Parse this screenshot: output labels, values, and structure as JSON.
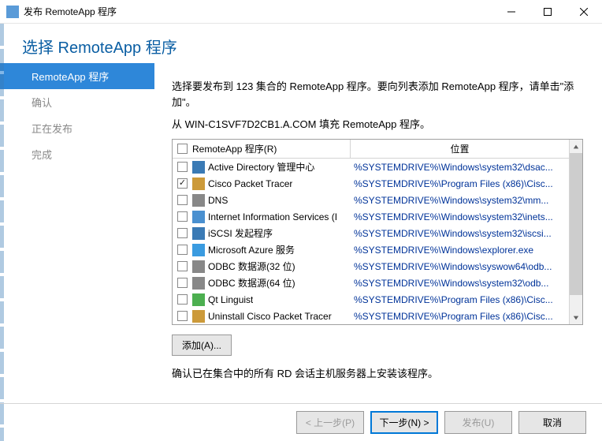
{
  "window": {
    "title": "发布 RemoteApp 程序",
    "min": "—",
    "max": "☐",
    "close": "✕"
  },
  "heading": "选择 RemoteApp 程序",
  "steps": [
    {
      "label": "RemoteApp 程序",
      "active": true
    },
    {
      "label": "确认",
      "active": false
    },
    {
      "label": "正在发布",
      "active": false
    },
    {
      "label": "完成",
      "active": false
    }
  ],
  "content": {
    "desc1": "选择要发布到 123 集合的 RemoteApp 程序。要向列表添加 RemoteApp 程序，请单击\"添加\"。",
    "desc2": "从 WIN-C1SVF7D2CB1.A.COM 填充 RemoteApp 程序。",
    "col1": "RemoteApp 程序(R)",
    "col2": "位置",
    "rows": [
      {
        "checked": false,
        "icon": "#3a7ab5",
        "name": "Active Directory 管理中心",
        "loc": "%SYSTEMDRIVE%\\Windows\\system32\\dsac..."
      },
      {
        "checked": true,
        "icon": "#cc9a3a",
        "name": "Cisco Packet Tracer",
        "loc": "%SYSTEMDRIVE%\\Program Files (x86)\\Cisc..."
      },
      {
        "checked": false,
        "icon": "#888888",
        "name": "DNS",
        "loc": "%SYSTEMDRIVE%\\Windows\\system32\\mm..."
      },
      {
        "checked": false,
        "icon": "#4a90d0",
        "name": "Internet Information Services (I",
        "loc": "%SYSTEMDRIVE%\\Windows\\system32\\inets..."
      },
      {
        "checked": false,
        "icon": "#3a7ab5",
        "name": "iSCSI 发起程序",
        "loc": "%SYSTEMDRIVE%\\Windows\\system32\\iscsi..."
      },
      {
        "checked": false,
        "icon": "#3a9be0",
        "name": "Microsoft Azure 服务",
        "loc": "%SYSTEMDRIVE%\\Windows\\explorer.exe"
      },
      {
        "checked": false,
        "icon": "#888888",
        "name": "ODBC 数据源(32 位)",
        "loc": "%SYSTEMDRIVE%\\Windows\\syswow64\\odb..."
      },
      {
        "checked": false,
        "icon": "#888888",
        "name": "ODBC 数据源(64 位)",
        "loc": "%SYSTEMDRIVE%\\Windows\\system32\\odb..."
      },
      {
        "checked": false,
        "icon": "#4caf50",
        "name": "Qt Linguist",
        "loc": "%SYSTEMDRIVE%\\Program Files (x86)\\Cisc..."
      },
      {
        "checked": false,
        "icon": "#cc9a3a",
        "name": "Uninstall Cisco Packet Tracer",
        "loc": "%SYSTEMDRIVE%\\Program Files (x86)\\Cisc..."
      }
    ],
    "addBtn": "添加(A)...",
    "note": "确认已在集合中的所有 RD 会话主机服务器上安装该程序。"
  },
  "footer": {
    "prev": "< 上一步(P)",
    "next": "下一步(N) >",
    "publish": "发布(U)",
    "cancel": "取消"
  }
}
